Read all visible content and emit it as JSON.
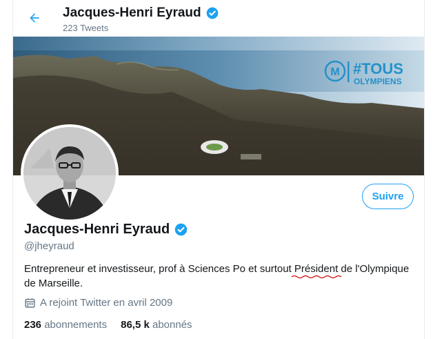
{
  "header": {
    "name": "Jacques-Henri Eyraud",
    "tweet_count": "223 Tweets"
  },
  "banner": {
    "hashtag_line1": "#TOUS",
    "hashtag_line2": "OLYMPIENS"
  },
  "profile": {
    "name": "Jacques-Henri Eyraud",
    "handle": "@jheyraud",
    "bio_before": "Entrepreneur et investisseur, prof à Sciences Po et surtout ",
    "bio_highlight": "Président",
    "bio_after": " de l'Olympique de Marseille.",
    "joined": "A rejoint Twitter en avril 2009",
    "following_count": "236",
    "following_label": "abonnements",
    "followers_count": "86,5 k",
    "followers_label": "abonnés",
    "follow_button": "Suivre"
  },
  "colors": {
    "accent": "#1da1f2",
    "spellcheck": "#d40000",
    "secondary_text": "#657786"
  },
  "icons": [
    "back-arrow-icon",
    "verified-badge-icon",
    "calendar-icon"
  ]
}
